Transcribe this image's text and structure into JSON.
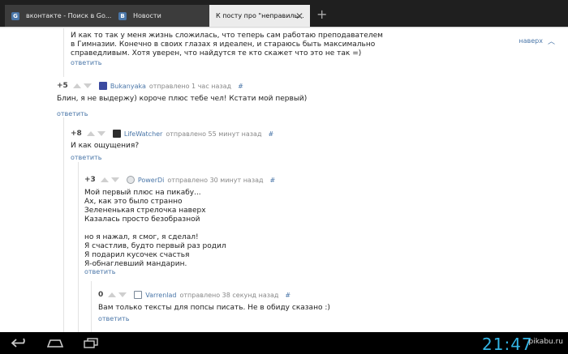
{
  "tabs": [
    {
      "label": "вконтакте - Поиск в Go...",
      "favicon": "G"
    },
    {
      "label": "Новости",
      "favicon": "B"
    },
    {
      "label": "К посту про \"неправиль...",
      "favicon": ""
    }
  ],
  "page": {
    "naverh": "наверх",
    "reply_label": "ответить",
    "first_text": "И как то так у меня жизнь сложилась, что теперь сам работаю преподавателем\nв Гимназии. Конечно в своих глазах я идеален, и стараюсь быть максимально\nсправедливым. Хотя уверен, что найдутся те кто скажет что это не так =)",
    "comments": [
      {
        "rating": "+5",
        "user": "Bukanyaka",
        "time": "отправлено 1 час назад",
        "hash": "#",
        "text": "Блин, я не выдержу) короче плюс тебе чел! Кстати мой первый)",
        "avatar_color": "#3b4aa0"
      },
      {
        "rating": "+8",
        "user": "LifeWatcher",
        "time": "отправлено 55 минут назад",
        "hash": "#",
        "text": "И как ощущения?",
        "avatar_color": "#2d2d2d"
      },
      {
        "rating": "+3",
        "user": "PowerDi",
        "time": "отправлено 30 минут назад",
        "hash": "#",
        "text": "Мой первый плюс на пикабу...\nАх, как это было странно\nЗелененькая стрелочка наверх\nКазалась просто безобразной\n\nно я нажал, я смог, я сделал!\nЯ счастлив, будто первый раз родил\nЯ подарил кусочек счастья\nЯ-обнаглевший мандарин.",
        "avatar_color": "#9aa0a6"
      },
      {
        "rating": "0",
        "user": "Varrenlad",
        "time": "отправлено 38 секунд назад",
        "hash": "#",
        "text": "Вам только тексты для попсы писать. Не в обиду сказано :)",
        "avatar_color": "#7a8899"
      }
    ]
  },
  "system": {
    "clock": "21:47",
    "watermark": "pikabu.ru"
  }
}
